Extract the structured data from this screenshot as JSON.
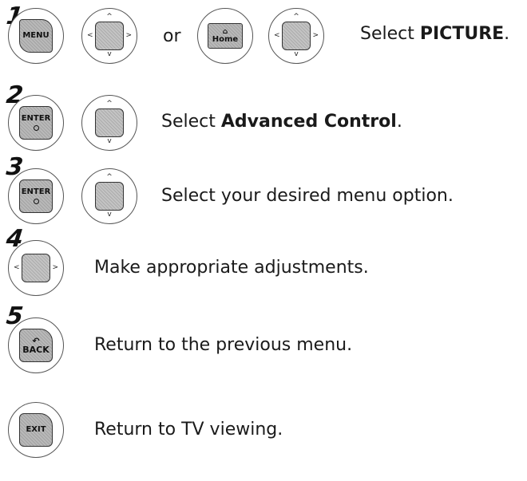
{
  "steps": [
    {
      "number": "1",
      "keys": [
        "MENU",
        "nav"
      ],
      "alt_keys": [
        "Home",
        "nav"
      ],
      "or_text": "or",
      "text_prefix": "Select ",
      "text_bold": "PICTURE",
      "text_suffix": "."
    },
    {
      "number": "2",
      "keys": [
        "ENTER",
        "nav-vertical"
      ],
      "text_prefix": "Select ",
      "text_bold": "Advanced Control",
      "text_suffix": "."
    },
    {
      "number": "3",
      "keys": [
        "ENTER",
        "nav-vertical"
      ],
      "text_prefix": "Select your desired menu option.",
      "text_bold": "",
      "text_suffix": ""
    },
    {
      "number": "4",
      "keys": [
        "nav-horizontal"
      ],
      "text_prefix": "Make appropriate adjustments.",
      "text_bold": "",
      "text_suffix": ""
    },
    {
      "number": "5",
      "keys": [
        "BACK"
      ],
      "text_prefix": "Return to the previous menu.",
      "text_bold": "",
      "text_suffix": ""
    },
    {
      "number": "",
      "keys": [
        "EXIT"
      ],
      "text_prefix": "Return to TV viewing.",
      "text_bold": "",
      "text_suffix": ""
    }
  ],
  "key_labels": {
    "menu": "MENU",
    "home": "Home",
    "enter": "ENTER",
    "back": "BACK",
    "exit": "EXIT"
  },
  "arrows": {
    "up": "^",
    "down": "v",
    "left": "<",
    "right": ">"
  }
}
